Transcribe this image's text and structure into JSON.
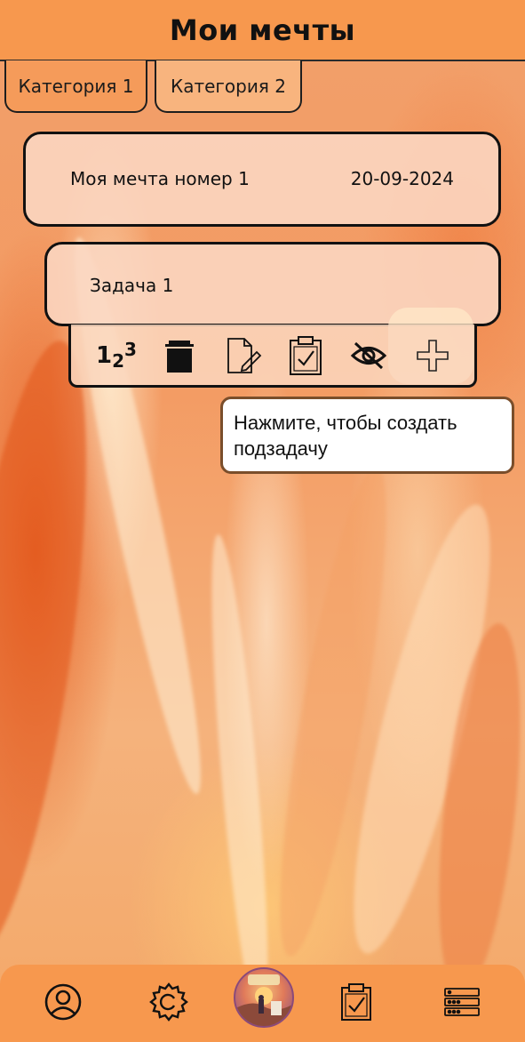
{
  "header": {
    "title": "Мои мечты"
  },
  "tabs": [
    {
      "label": "Категория 1",
      "selected": true
    },
    {
      "label": "Категория 2",
      "selected": false
    }
  ],
  "dream": {
    "title": "Моя мечта номер 1",
    "date": "20-09-2024"
  },
  "task": {
    "title": "Задача 1"
  },
  "toolbar": {
    "items": [
      {
        "icon": "numbering-icon",
        "label": "123"
      },
      {
        "icon": "trash-icon"
      },
      {
        "icon": "edit-document-icon"
      },
      {
        "icon": "clipboard-check-icon"
      },
      {
        "icon": "eye-hidden-icon"
      },
      {
        "icon": "plus-icon",
        "highlighted": true
      }
    ]
  },
  "tooltip": {
    "text": "Нажмите, чтобы создать подзадачу"
  },
  "bottom_nav": {
    "items": [
      {
        "icon": "profile-icon"
      },
      {
        "icon": "settings-icon"
      },
      {
        "icon": "app-logo-icon"
      },
      {
        "icon": "clipboard-check-icon"
      },
      {
        "icon": "list-menu-icon"
      }
    ]
  },
  "colors": {
    "header_bg": "#f7984e",
    "tab_active": "#f59b5a",
    "tab_inactive": "#f8b47e",
    "card_bg": "#fad7c3",
    "tooltip_border": "#7a4e2b"
  }
}
